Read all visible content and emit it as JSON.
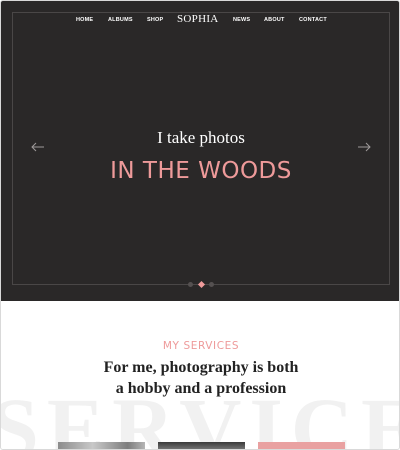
{
  "nav": {
    "items_left": [
      "HOME",
      "ALBUMS",
      "SHOP"
    ],
    "logo": "SOPHIA",
    "items_right": [
      "NEWS",
      "ABOUT",
      "CONTACT"
    ]
  },
  "hero": {
    "subtitle": "I take photos",
    "headline": "IN THE WOODS",
    "prev_icon": "arrow-left-icon",
    "next_icon": "arrow-right-icon",
    "slides_count": 3,
    "active_slide": 2
  },
  "services": {
    "eyebrow": "MY SERVICES",
    "heading": "For me, photography is both a hobby and a profession",
    "watermark": "SERVICES"
  },
  "colors": {
    "hero_bg": "#2a2828",
    "accent": "#ee9a9a",
    "text_dark": "#222222"
  }
}
